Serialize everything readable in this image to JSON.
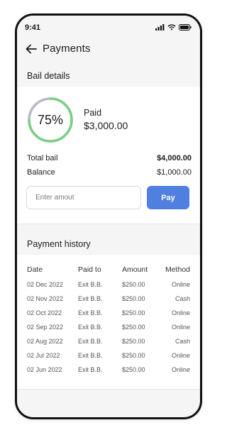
{
  "status_bar": {
    "time": "9:41"
  },
  "header": {
    "title": "Payments"
  },
  "bail_details": {
    "section_title": "Bail details",
    "progress_percent": 75,
    "progress_label": "75%",
    "paid_label": "Paid",
    "paid_amount": "$3,000.00",
    "total_bail_label": "Total bail",
    "total_bail_value": "$4,000.00",
    "balance_label": "Balance",
    "balance_value": "$1,000.00",
    "amount_placeholder": "Enter amout",
    "pay_label": "Pay"
  },
  "payment_history": {
    "section_title": "Payment history",
    "columns": [
      "Date",
      "Paid to",
      "Amount",
      "Method"
    ],
    "rows": [
      {
        "date": "02 Dec 2022",
        "paid_to": "Exit B.B.",
        "amount": "$250.00",
        "method": "Online"
      },
      {
        "date": "02 Nov 2022",
        "paid_to": "Exit B.B.",
        "amount": "$250.00",
        "method": "Cash"
      },
      {
        "date": "02 Oct 2022",
        "paid_to": "Exit B.B.",
        "amount": "$250.00",
        "method": "Online"
      },
      {
        "date": "02 Sep 2022",
        "paid_to": "Exit B.B.",
        "amount": "$250.00",
        "method": "Online"
      },
      {
        "date": "02 Aug 2022",
        "paid_to": "Exit B.B.",
        "amount": "$250.00",
        "method": "Cash"
      },
      {
        "date": "02 Jul 2022",
        "paid_to": "Exit B.B.",
        "amount": "$250.00",
        "method": "Online"
      },
      {
        "date": "02 Jun 2022",
        "paid_to": "Exit B.B.",
        "amount": "$250.00",
        "method": "Online"
      }
    ]
  },
  "colors": {
    "progress": "#7ccf84",
    "progress_track": "#b9b9c8",
    "pay_button": "#4f7fe0"
  },
  "icons": {
    "back": "arrow-left-icon",
    "signal": "signal-icon",
    "wifi": "wifi-icon",
    "battery": "battery-icon"
  }
}
